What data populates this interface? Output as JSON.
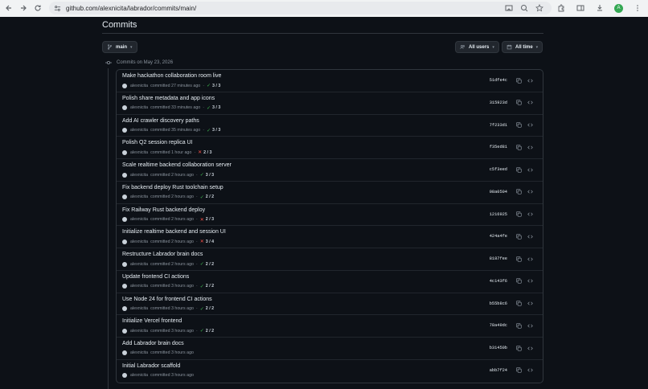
{
  "browser": {
    "url": "github.com/alexnicita/labrador/commits/main/",
    "profile_initial": "A",
    "profile_color": "#34a853"
  },
  "page": {
    "title": "Commits",
    "branch_label": "main",
    "users_filter": "All users",
    "time_filter": "All time",
    "date_heading": "Commits on May 23, 2026"
  },
  "colors": {
    "success": "#3fb950",
    "failure": "#f85149",
    "background": "#0d1117",
    "border": "#30363d"
  },
  "commits": [
    {
      "title": "Make hackathon collaboration room live",
      "author": "alexnicita",
      "time": "committed 27 minutes ago",
      "status": "success",
      "checks": "3 / 3",
      "sha": "51dfe4c"
    },
    {
      "title": "Polish share metadata and app icons",
      "author": "alexnicita",
      "time": "committed 33 minutes ago",
      "status": "success",
      "checks": "3 / 3",
      "sha": "315923d"
    },
    {
      "title": "Add AI crawler discovery paths",
      "author": "alexnicita",
      "time": "committed 35 minutes ago",
      "status": "success",
      "checks": "3 / 3",
      "sha": "7f233d1"
    },
    {
      "title": "Polish Q2 session replica UI",
      "author": "alexnicita",
      "time": "committed 1 hour ago",
      "status": "failure",
      "checks": "2 / 3",
      "sha": "f35ed81"
    },
    {
      "title": "Scale realtime backend collaboration server",
      "author": "alexnicita",
      "time": "committed 2 hours ago",
      "status": "success",
      "checks": "3 / 3",
      "sha": "c5f3eed"
    },
    {
      "title": "Fix backend deploy Rust toolchain setup",
      "author": "alexnicita",
      "time": "committed 2 hours ago",
      "status": "success",
      "checks": "2 / 2",
      "sha": "08a0504"
    },
    {
      "title": "Fix Railway Rust backend deploy",
      "author": "alexnicita",
      "time": "committed 2 hours ago",
      "status": "failure",
      "checks": "2 / 3",
      "sha": "1216925"
    },
    {
      "title": "Initialize realtime backend and session UI",
      "author": "alexnicita",
      "time": "committed 2 hours ago",
      "status": "failure",
      "checks": "3 / 4",
      "sha": "424a4fe"
    },
    {
      "title": "Restructure Labrador brain docs",
      "author": "alexnicita",
      "time": "committed 2 hours ago",
      "status": "success",
      "checks": "2 / 2",
      "sha": "8187fee"
    },
    {
      "title": "Update frontend CI actions",
      "author": "alexnicita",
      "time": "committed 3 hours ago",
      "status": "success",
      "checks": "2 / 2",
      "sha": "4c143f6"
    },
    {
      "title": "Use Node 24 for frontend CI actions",
      "author": "alexnicita",
      "time": "committed 3 hours ago",
      "status": "success",
      "checks": "2 / 2",
      "sha": "b55b8c6"
    },
    {
      "title": "Initialize Vercel frontend",
      "author": "alexnicita",
      "time": "committed 3 hours ago",
      "status": "success",
      "checks": "2 / 2",
      "sha": "78a49dc"
    },
    {
      "title": "Add Labrador brain docs",
      "author": "alexnicita",
      "time": "committed 3 hours ago",
      "status": "none",
      "checks": "",
      "sha": "b31450b"
    },
    {
      "title": "Initial Labrador scaffold",
      "author": "alexnicita",
      "time": "committed 3 hours ago",
      "status": "none",
      "checks": "",
      "sha": "abb7f24"
    }
  ]
}
